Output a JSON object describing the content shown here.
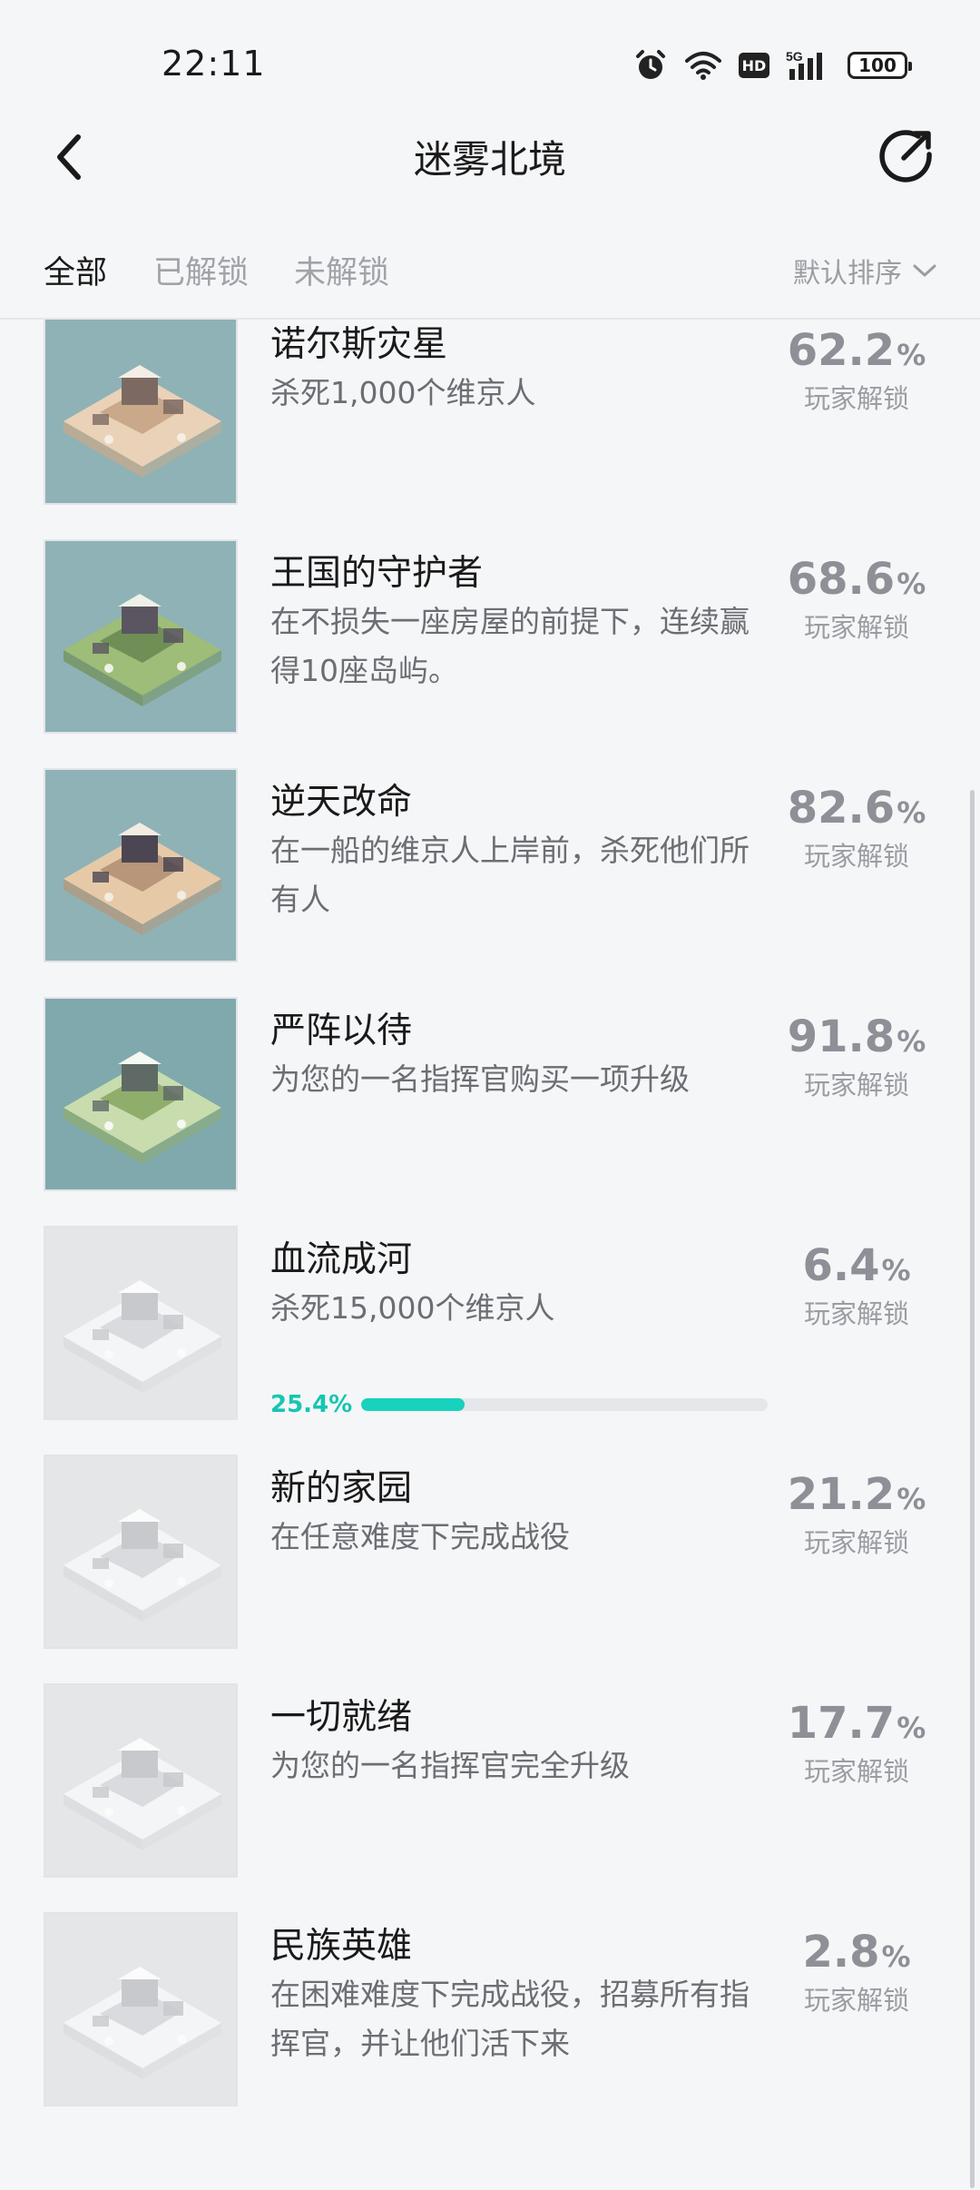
{
  "status_bar": {
    "time": "22:11",
    "battery": "100",
    "network": "5G",
    "hd_label": "HD",
    "icons": [
      "alarm-icon",
      "wifi-icon",
      "hd-icon",
      "signal-icon",
      "battery-icon"
    ]
  },
  "header": {
    "title": "迷雾北境",
    "back_icon": "chevron-left-icon",
    "share_icon": "share-icon"
  },
  "tabs": {
    "all": "全部",
    "unlocked": "已解锁",
    "locked": "未解锁",
    "active": "all"
  },
  "sort": {
    "label": "默认排序",
    "icon": "chevron-down-icon"
  },
  "colors": {
    "accent": "#17d2bc",
    "accent_text": "#14c6b1",
    "percent_gray": "#8d9096",
    "background": "#f5f6f8"
  },
  "achievements": [
    {
      "title": "诺尔斯灾星",
      "desc": "杀死1,000个维京人",
      "percent": "62.2",
      "pct_sign": "%",
      "label": "玩家解锁",
      "unlocked": true,
      "palette": "sand"
    },
    {
      "title": "王国的守护者",
      "desc": "在不损失一座房屋的前提下，连续赢得10座岛屿。",
      "percent": "68.6",
      "pct_sign": "%",
      "label": "玩家解锁",
      "unlocked": true,
      "palette": "green"
    },
    {
      "title": "逆天改命",
      "desc": "在一船的维京人上岸前，杀死他们所有人",
      "percent": "82.6",
      "pct_sign": "%",
      "label": "玩家解锁",
      "unlocked": true,
      "palette": "sand-dark"
    },
    {
      "title": "严阵以待",
      "desc": "为您的一名指挥官购买一项升级",
      "percent": "91.8",
      "pct_sign": "%",
      "label": "玩家解锁",
      "unlocked": true,
      "palette": "green-snow"
    },
    {
      "title": "血流成河",
      "desc": "杀死15,000个维京人",
      "percent": "6.4",
      "pct_sign": "%",
      "label": "玩家解锁",
      "unlocked": false,
      "palette": "gray",
      "progress": 0.254,
      "progress_text": "25.4%"
    },
    {
      "title": "新的家园",
      "desc": "在任意难度下完成战役",
      "percent": "21.2",
      "pct_sign": "%",
      "label": "玩家解锁",
      "unlocked": false,
      "palette": "gray"
    },
    {
      "title": "一切就绪",
      "desc": "为您的一名指挥官完全升级",
      "percent": "17.7",
      "pct_sign": "%",
      "label": "玩家解锁",
      "unlocked": false,
      "palette": "gray"
    },
    {
      "title": "民族英雄",
      "desc": "在困难难度下完成战役，招募所有指挥官，并让他们活下来",
      "percent": "2.8",
      "pct_sign": "%",
      "label": "玩家解锁",
      "unlocked": false,
      "palette": "gray"
    }
  ]
}
